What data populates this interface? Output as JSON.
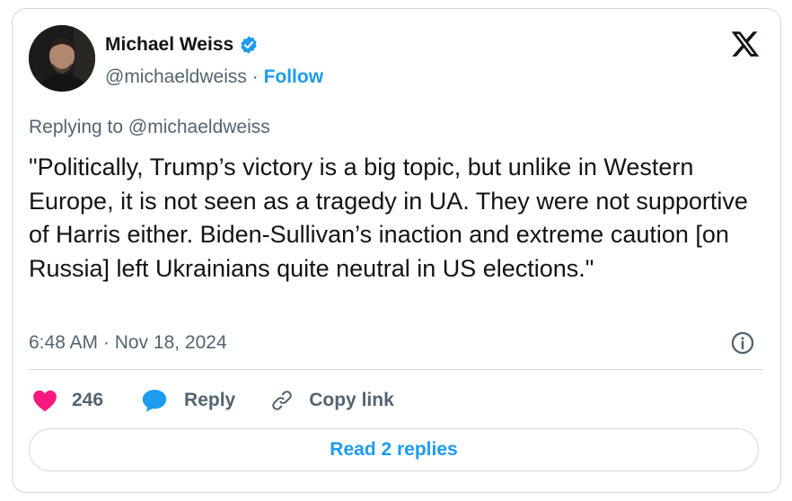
{
  "author": {
    "name": "Michael Weiss",
    "handle": "@michaeldweiss",
    "separator": "·",
    "follow_label": "Follow",
    "verified": true
  },
  "tweet": {
    "replying_prefix": "Replying to",
    "replying_to": "@michaeldweiss",
    "text": "\"Politically, Trump’s victory is a big topic, but unlike in Western Europe, it is not seen as a tragedy in UA. They were not supportive of Harris either. Biden-Sullivan’s inaction and extreme caution [on Russia] left Ukrainians quite neutral in US elections.\"",
    "timestamp": "6:48 AM · Nov 18, 2024"
  },
  "actions": {
    "like_count": "246",
    "reply_label": "Reply",
    "copy_link_label": "Copy link"
  },
  "footer": {
    "read_replies_label": "Read 2 replies"
  },
  "colors": {
    "accent": "#1d9bf0",
    "like": "#f91880",
    "muted": "#536471",
    "border": "#cfd9de"
  },
  "icons": {
    "verified": "verified-badge-icon",
    "logo": "x-logo-icon",
    "info": "info-icon",
    "like": "heart-icon",
    "reply": "speech-bubble-icon",
    "copy": "link-icon"
  }
}
